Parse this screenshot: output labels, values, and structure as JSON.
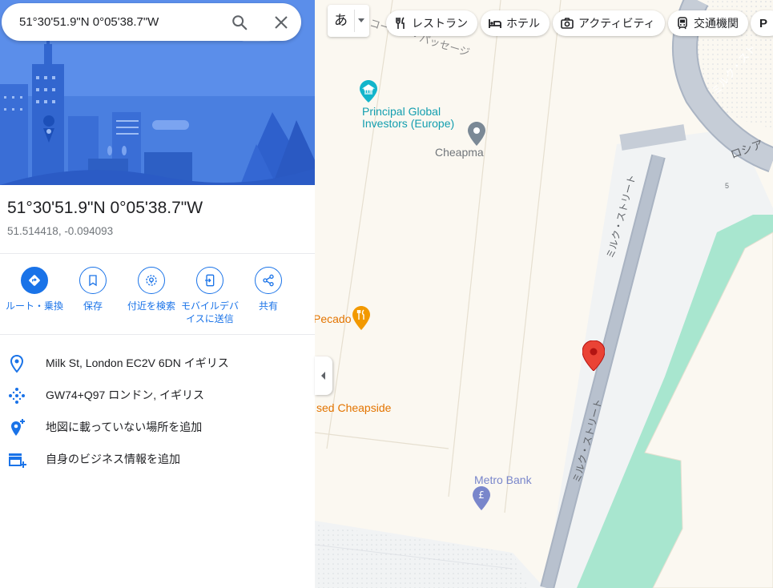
{
  "search": {
    "query": "51°30'51.9\"N 0°05'38.7\"W"
  },
  "place": {
    "title": "51°30'51.9\"N 0°05'38.7\"W",
    "coords": "51.514418, -0.094093"
  },
  "actions": [
    {
      "label": "ルート・乗換",
      "icon": "directions-icon"
    },
    {
      "label": "保存",
      "icon": "bookmark-icon"
    },
    {
      "label": "付近を検索",
      "icon": "nearby-search-icon"
    },
    {
      "label": "モバイルデバイスに送信",
      "icon": "send-to-phone-icon"
    },
    {
      "label": "共有",
      "icon": "share-icon"
    }
  ],
  "info": [
    {
      "text": "Milk St, London EC2V 6DN イギリス",
      "icon": "location-pin-icon"
    },
    {
      "text": "GW74+Q97 ロンドン, イギリス",
      "icon": "plus-code-icon"
    },
    {
      "text": "地図に載っていない場所を追加",
      "icon": "add-place-icon"
    },
    {
      "text": "自身のビジネス情報を追加",
      "icon": "add-business-icon"
    }
  ],
  "map": {
    "language_button": "あ",
    "chips": [
      {
        "label": "レストラン",
        "icon": "restaurant-icon"
      },
      {
        "label": "ホテル",
        "icon": "hotel-icon"
      },
      {
        "label": "アクティビティ",
        "icon": "camera-icon"
      },
      {
        "label": "交通機関",
        "icon": "transit-icon"
      },
      {
        "label": "P",
        "icon": "parking-icon"
      }
    ],
    "labels": {
      "passage": "コーター・パッセージ",
      "principal": [
        "Principal Global",
        "Investors (Europe)"
      ],
      "cheapma": "Cheapma",
      "pecado": "Pecado",
      "cheapside": "sed Cheapside",
      "metro_bank": "Metro Bank",
      "milk_street_upper": "ミルク・ストリート",
      "milk_street_lower": "ミルク・ストリート",
      "milk_street_top_right": "ミルク・スト",
      "russia": "ロシア",
      "number_5": "5"
    },
    "colors": {
      "land": "#fbf8f1",
      "road": "#f1f3f4",
      "street_fill": "#aab4c3",
      "green": "#a8e6cf",
      "pin": "#ea4335",
      "poi_teal": "#12b5cb",
      "poi_orange": "#f29900",
      "poi_grey": "#7b8996",
      "poi_bank": "#7986cb"
    }
  }
}
